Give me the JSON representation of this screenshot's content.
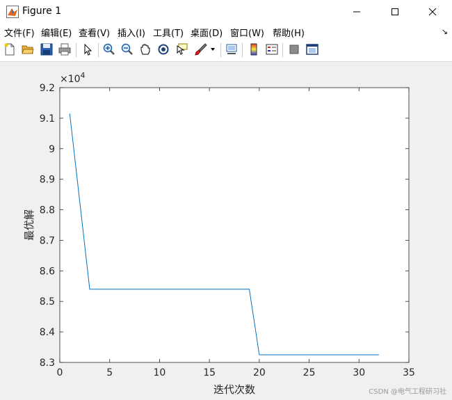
{
  "window": {
    "title": "Figure 1",
    "icon": "matlab-figure-icon",
    "controls": [
      "minimize-icon",
      "maximize-icon",
      "close-icon"
    ]
  },
  "menu": {
    "items": [
      {
        "label": "文件(F)"
      },
      {
        "label": "编辑(E)"
      },
      {
        "label": "查看(V)"
      },
      {
        "label": "插入(I)"
      },
      {
        "label": "工具(T)"
      },
      {
        "label": "桌面(D)"
      },
      {
        "label": "窗口(W)"
      },
      {
        "label": "帮助(H)"
      }
    ],
    "dock_arrow": "↘"
  },
  "toolbar": {
    "icons": [
      "new-figure-icon",
      "open-file-icon",
      "save-icon",
      "print-icon",
      "edit-plot-icon",
      "zoom-in-icon",
      "zoom-out-icon",
      "pan-icon",
      "rotate-3d-icon",
      "data-cursor-icon",
      "brush-icon",
      "link-plot-icon",
      "insert-colorbar-icon",
      "insert-legend-icon",
      "hide-plot-tools-icon",
      "show-plot-tools-icon"
    ]
  },
  "chart_data": {
    "type": "line",
    "xlabel": "迭代次数",
    "ylabel": "最优解",
    "exponent_label": "×10",
    "exponent_power": "4",
    "xlim": [
      0,
      35
    ],
    "ylim": [
      8.3,
      9.2
    ],
    "xticks": [
      "0",
      "5",
      "10",
      "15",
      "20",
      "25",
      "30",
      "35"
    ],
    "yticks": [
      "8.3",
      "8.4",
      "8.5",
      "8.6",
      "8.7",
      "8.8",
      "8.9",
      "9",
      "9.1",
      "9.2"
    ],
    "series": [
      {
        "color": "#0072bd",
        "x": [
          1,
          3,
          19,
          20,
          32
        ],
        "y": [
          9.115,
          8.54,
          8.54,
          8.325,
          8.325
        ]
      }
    ]
  },
  "watermark": "CSDN @电气工程研习社"
}
